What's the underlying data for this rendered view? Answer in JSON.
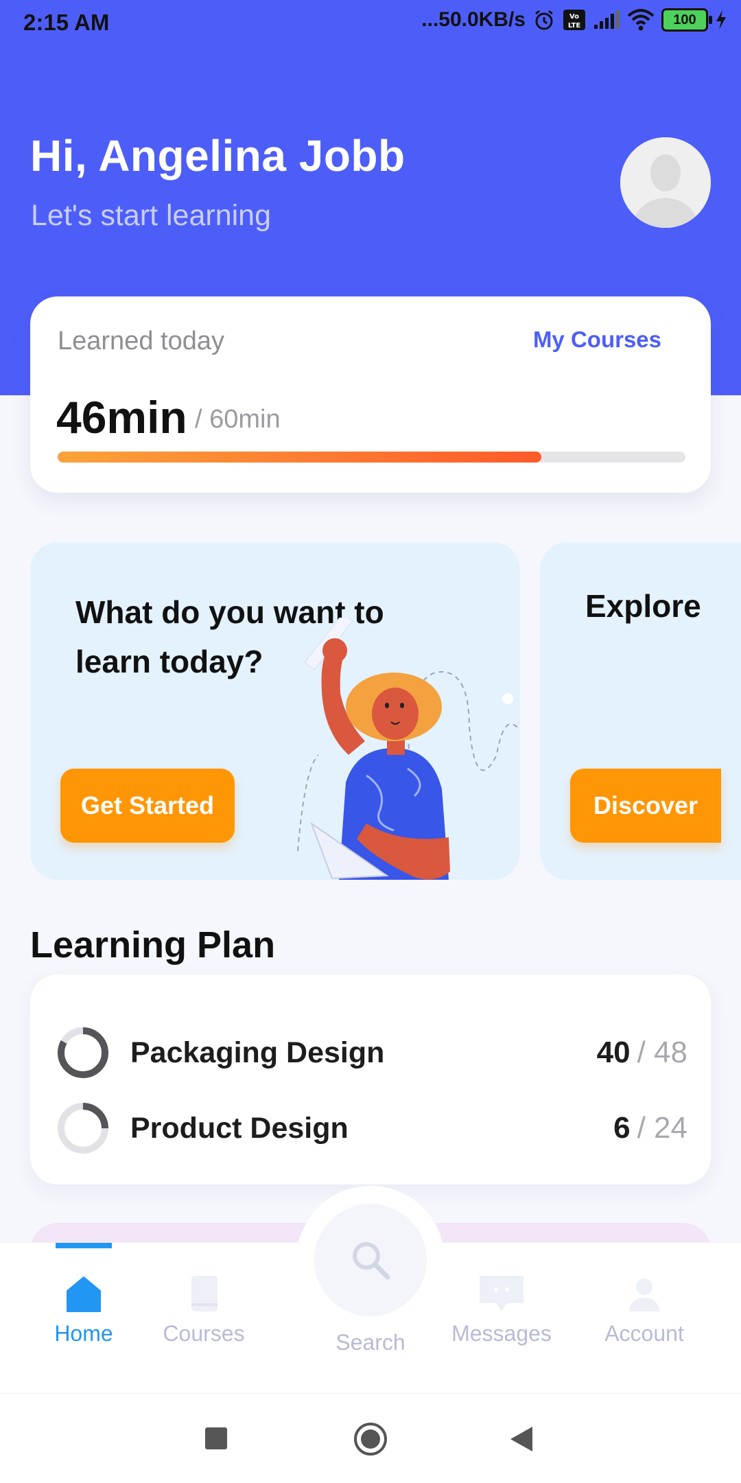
{
  "status_bar": {
    "time": "2:15 AM",
    "network_speed": "...50.0KB/s",
    "battery": "100",
    "icons": [
      "alarm-icon",
      "volte-icon",
      "signal-icon",
      "wifi-icon",
      "battery-icon",
      "charging-icon"
    ]
  },
  "header": {
    "greeting": "Hi, Angelina Jobb",
    "subtitle": "Let's start learning",
    "background_color": "#4D5EF8"
  },
  "learned_today": {
    "label": "Learned today",
    "link": "My Courses",
    "minutes": "46min",
    "goal": "/ 60min",
    "progress": 0.77
  },
  "promo_cards": [
    {
      "title": "What do you want to learn today?",
      "button": "Get Started"
    },
    {
      "title": "Explore",
      "button": "Discover"
    }
  ],
  "learning_plan": {
    "title": "Learning Plan",
    "items": [
      {
        "name": "Packaging Design",
        "done": "40",
        "total": "/ 48",
        "progress": 0.83
      },
      {
        "name": "Product Design",
        "done": "6",
        "total": "/ 24",
        "progress": 0.25
      }
    ]
  },
  "bottom_nav": {
    "items": [
      {
        "label": "Home",
        "icon": "home-icon",
        "active": true
      },
      {
        "label": "Courses",
        "icon": "book-icon",
        "active": false
      },
      {
        "label": "Search",
        "icon": "search-icon",
        "active": false
      },
      {
        "label": "Messages",
        "icon": "chat-icon",
        "active": false
      },
      {
        "label": "Account",
        "icon": "user-icon",
        "active": false
      }
    ]
  },
  "colors": {
    "accent": "#4D5EF8",
    "orange": "#FF9606",
    "active_nav": "#2196F3"
  }
}
